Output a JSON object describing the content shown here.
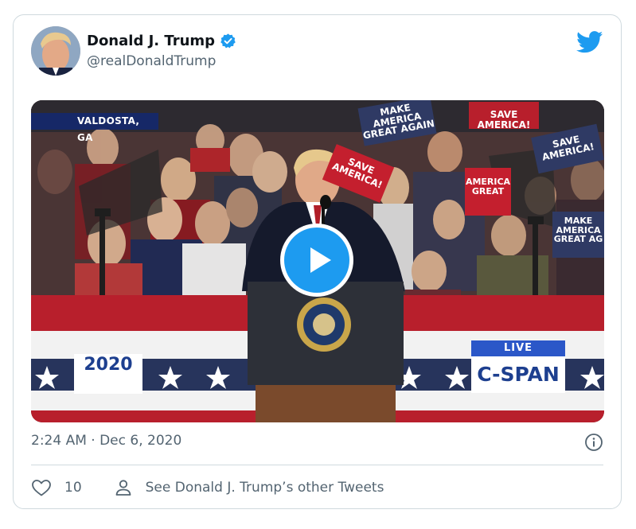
{
  "tweet": {
    "display_name": "Donald J. Trump",
    "handle": "@realDonaldTrump",
    "verified": true,
    "timestamp": "2:24 AM · Dec 6, 2020",
    "like_count": "10",
    "other_tweets_label": "See Donald J. Trump’s other Tweets"
  },
  "video": {
    "location_label": "VALDOSTA, GA",
    "logo_2020": "2020",
    "live_label": "LIVE",
    "network_label": "C-SPAN",
    "signs": {
      "make_america_great_again": "MAKE AMERICA GREAT AGAIN",
      "save_america": "SAVE AMERICA!",
      "save_america_top": "SAVE AMERICA!",
      "save_america_right": "SAVE AMERICA!",
      "america_great_right": "AMERICA GREAT",
      "make_america_great_right": "MAKE AMERICA GREAT AG"
    }
  },
  "icons": {
    "verified": "verified-badge-icon",
    "twitter": "twitter-bird-icon",
    "play": "play-icon",
    "info": "info-icon",
    "heart": "heart-icon",
    "person": "person-icon"
  },
  "colors": {
    "twitter_blue": "#1d9bf0",
    "secondary_text": "#536471",
    "border": "#cfd9de",
    "cspan_blue": "#2b57c8"
  }
}
